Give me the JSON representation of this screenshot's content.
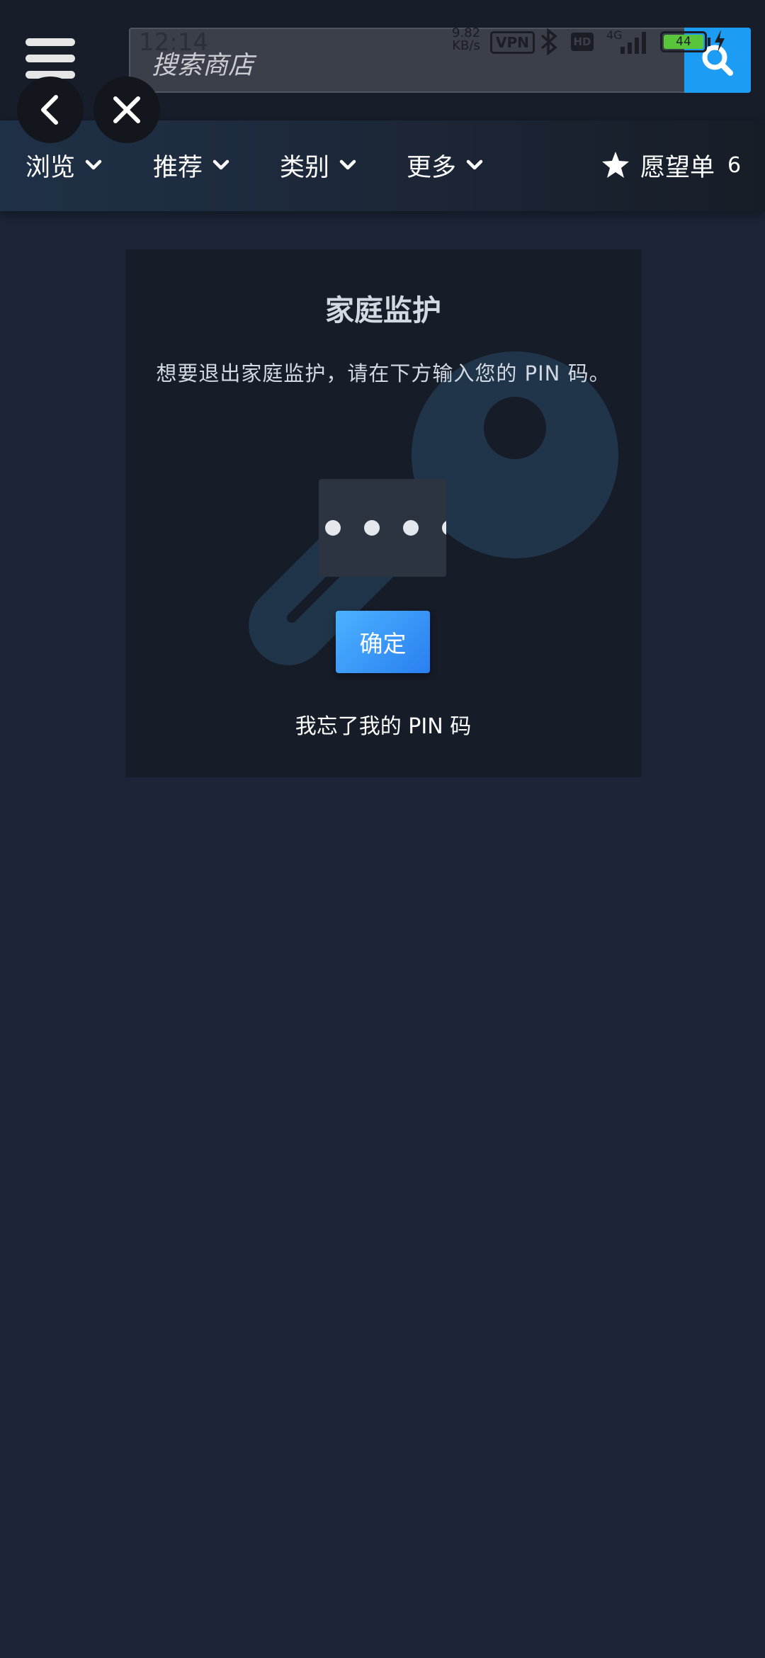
{
  "status_bar": {
    "time": "12:14",
    "net_speed_value": "9.82",
    "net_speed_unit": "KB/s",
    "vpn": "VPN",
    "hd": "HD",
    "network": "4G",
    "battery_level": "44"
  },
  "header": {
    "search_placeholder": "搜索商店"
  },
  "nav": {
    "items": [
      {
        "label": "浏览"
      },
      {
        "label": "推荐"
      },
      {
        "label": "类别"
      },
      {
        "label": "更多"
      }
    ],
    "wishlist_label": "愿望单",
    "wishlist_count": "6"
  },
  "parental": {
    "title": "家庭监护",
    "description": "想要退出家庭监护，请在下方输入您的 PIN 码。",
    "pin_digits_entered": 4,
    "confirm_label": "确定",
    "forgot_label": "我忘了我的 PIN 码"
  },
  "colors": {
    "background": "#1b2537",
    "accent": "#1c9cf2",
    "card": "#161c28"
  }
}
